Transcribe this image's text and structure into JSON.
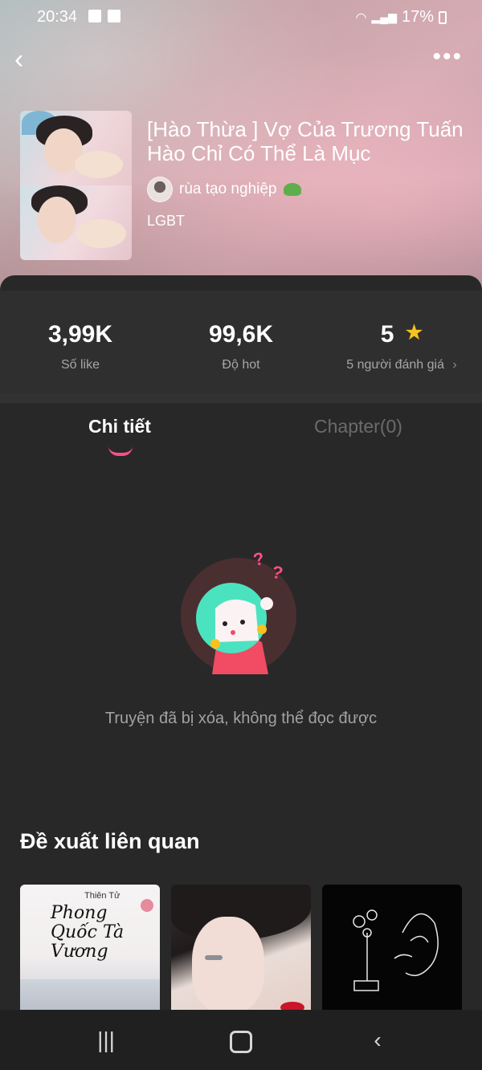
{
  "status_bar": {
    "time": "20:34",
    "battery": "17%"
  },
  "header": {
    "title": "[Hào Thừa ] Vợ Của Trương Tuấn Hào Chỉ Có Thể Là Mục",
    "author": "rùa tạo nghiệp",
    "tag": "LGBT"
  },
  "stats": {
    "likes_value": "3,99K",
    "likes_label": "Số like",
    "hot_value": "99,6K",
    "hot_label": "Độ hot",
    "rating_value": "5",
    "rating_label": "5 người đánh giá"
  },
  "tabs": [
    {
      "label": "Chi tiết",
      "active": true
    },
    {
      "label": "Chapter(0)",
      "active": false
    }
  ],
  "empty_state": {
    "message": "Truyện đã bị xóa, không thể đọc được"
  },
  "recommendations": {
    "title": "Đề xuất liên quan",
    "cards": [
      {
        "cover_text": "Phong Quốc Tà Vương",
        "author_text": "Thiên Tử"
      },
      {
        "cover_text": ""
      },
      {
        "cover_text": ""
      }
    ]
  },
  "icons": {
    "back": "chevron-left-icon",
    "more": "more-dots-icon",
    "star": "star-icon",
    "chevron": "chevron-right-icon",
    "nav_recent": "recent-apps-icon",
    "nav_home": "home-icon",
    "nav_back": "nav-back-icon"
  },
  "colors": {
    "accent": "#ff4f87",
    "star": "#f7c21e",
    "background": "#282828"
  }
}
